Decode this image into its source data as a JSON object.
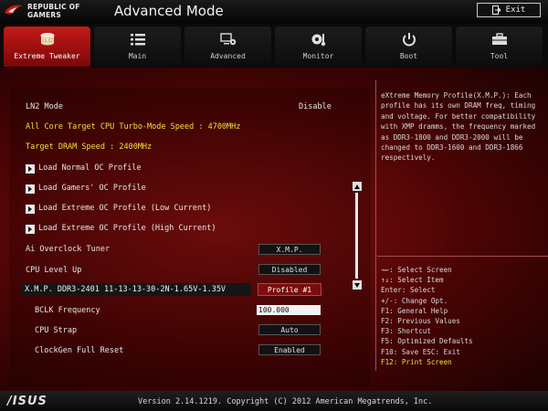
{
  "header": {
    "brand_line1": "REPUBLIC OF",
    "brand_line2": "GAMERS",
    "mode_title": "Advanced Mode",
    "exit_label": "Exit"
  },
  "tabs": [
    {
      "label": "Extreme Tweaker",
      "icon": "cpu-chip-icon",
      "active": true
    },
    {
      "label": "Main",
      "icon": "list-icon",
      "active": false
    },
    {
      "label": "Advanced",
      "icon": "settings-monitor-icon",
      "active": false
    },
    {
      "label": "Monitor",
      "icon": "fan-gauge-icon",
      "active": false
    },
    {
      "label": "Boot",
      "icon": "power-icon",
      "active": false
    },
    {
      "label": "Tool",
      "icon": "toolbox-icon",
      "active": false
    }
  ],
  "settings": {
    "ln2_mode_label": "LN2 Mode",
    "ln2_mode_value": "Disable",
    "cpu_turbo_info": "All Core Target CPU Turbo-Mode Speed : 4700MHz",
    "dram_speed_info": "Target DRAM Speed : 2400MHz",
    "submenus": [
      "Load Normal OC Profile",
      "Load Gamers' OC Profile",
      "Load Extreme OC Profile (Low Current)",
      "Load Extreme OC Profile (High Current)"
    ],
    "ai_tuner_label": "Ai Overclock Tuner",
    "ai_tuner_value": "X.M.P.",
    "cpu_level_label": "CPU Level Up",
    "cpu_level_value": "Disabled",
    "xmp_label": "X.M.P. DDR3-2401 11-13-13-30-2N-1.65V-1.35V",
    "xmp_value": "Profile #1",
    "bclk_label": "BCLK Frequency",
    "bclk_value": "100.000",
    "cpu_strap_label": "CPU Strap",
    "cpu_strap_value": "Auto",
    "clockgen_label": "ClockGen Full Reset",
    "clockgen_value": "Enabled"
  },
  "help": {
    "description": "eXtreme Memory Profile(X.M.P.): Each profile has its own DRAM freq, timing and voltage. For better compatibility with XMP dramms, the frequency marked as DDR3-1800 and DDR3-2000 will be changed to DDR3-1600 and DDR3-1866 respectively."
  },
  "keys": [
    "→←: Select Screen",
    "↑↓: Select Item",
    "Enter: Select",
    "+/-: Change Opt.",
    "F1: General Help",
    "F2: Previous Values",
    "F3: Shortcut",
    "F5: Optimized Defaults",
    "F10: Save  ESC: Exit",
    "F12: Print Screen"
  ],
  "footer": {
    "brand": "/ISUS",
    "version": "Version 2.14.1219. Copyright (C) 2012 American Megatrends, Inc."
  },
  "colors": {
    "accent_red": "#c41a1a",
    "highlight_yellow": "#f0e040"
  }
}
